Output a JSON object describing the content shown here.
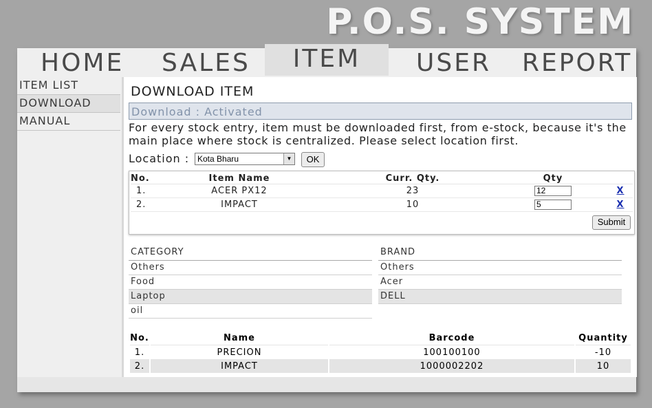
{
  "app": {
    "title": "P.O.S. SYSTEM"
  },
  "nav": [
    {
      "label": "HOME"
    },
    {
      "label": "SALES"
    },
    {
      "label": "ITEM"
    },
    {
      "label": "USER"
    },
    {
      "label": "REPORT"
    }
  ],
  "sidebar": [
    {
      "label": "ITEM LIST"
    },
    {
      "label": "DOWNLOAD"
    },
    {
      "label": "MANUAL"
    }
  ],
  "page": {
    "title": "DOWNLOAD ITEM",
    "status": "Download : Activated",
    "description": "For every stock entry, item must be downloaded first, from e-stock, because it's the main place where stock is centralized. Please select location first."
  },
  "location": {
    "label": "Location :",
    "selected": "Kota Bharu",
    "ok_label": "OK"
  },
  "download_table": {
    "headers": [
      "No.",
      "Item Name",
      "Curr. Qty.",
      "Qty"
    ],
    "rows": [
      {
        "no": "1.",
        "name": "ACER PX12",
        "curr_qty": "23",
        "qty": "12",
        "delete": "X"
      },
      {
        "no": "2.",
        "name": "IMPACT",
        "curr_qty": "10",
        "qty": "5",
        "delete": "X"
      }
    ],
    "submit_label": "Submit"
  },
  "category": {
    "header": "CATEGORY",
    "items": [
      "Others",
      "Food",
      "Laptop",
      "oil"
    ]
  },
  "brand": {
    "header": "BRAND",
    "items": [
      "Others",
      "Acer",
      "DELL"
    ]
  },
  "stock_table": {
    "headers": [
      "No.",
      "Name",
      "Barcode",
      "Quantity"
    ],
    "rows": [
      {
        "no": "1.",
        "name": "PRECION",
        "barcode": "100100100",
        "quantity": "-10"
      },
      {
        "no": "2.",
        "name": "IMPACT",
        "barcode": "1000002202",
        "quantity": "10"
      }
    ]
  }
}
